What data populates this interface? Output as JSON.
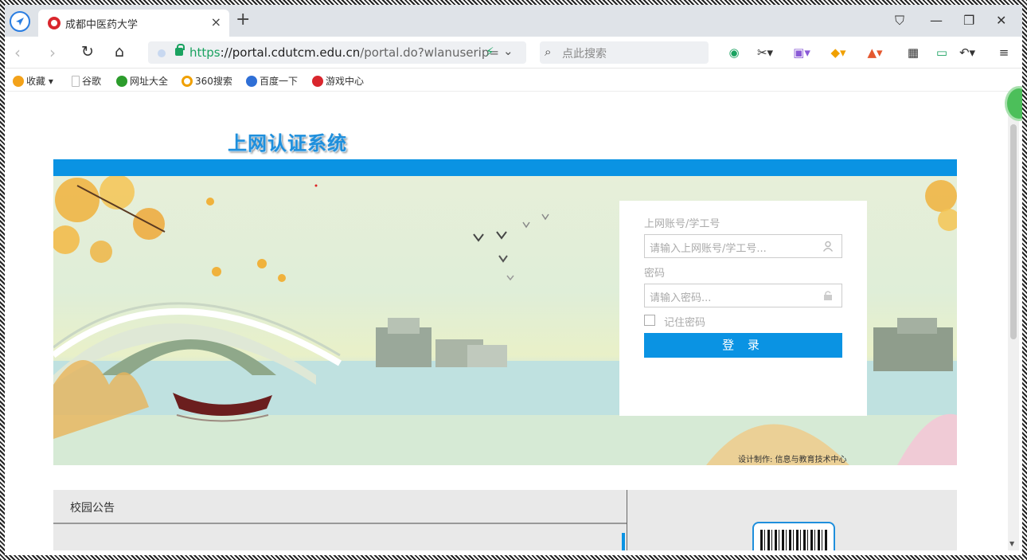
{
  "browser": {
    "tab_title": "成都中医药大学",
    "tab_close": "×",
    "new_tab": "+",
    "url_scheme": "https",
    "url_host": "://portal.cdutcm.edu.cn",
    "url_path": "/portal.do?wlanuserip=",
    "search_placeholder": "点此搜索",
    "window_controls": {
      "skin": "⛉",
      "minimize": "—",
      "restore": "❐",
      "close": "✕"
    },
    "toolbar_icons": [
      "shield-icon",
      "scissors-icon",
      "translate-icon",
      "coin-icon",
      "game-icon",
      "apps-icon",
      "battery-icon",
      "undo-icon",
      "menu-icon"
    ]
  },
  "bookmarks": [
    {
      "label": "收藏",
      "icon": "star-icon",
      "color": "#f3a21a"
    },
    {
      "label": "谷歌",
      "icon": "page-icon",
      "color": "#cccccc"
    },
    {
      "label": "网址大全",
      "icon": "globe-icon",
      "color": "#2c9c2c"
    },
    {
      "label": "360搜索",
      "icon": "search-360-icon",
      "color": "#f0a000"
    },
    {
      "label": "百度一下",
      "icon": "paw-icon",
      "color": "#2f6fd6"
    },
    {
      "label": "游戏中心",
      "icon": "game-center-icon",
      "color": "#d9262d"
    }
  ],
  "page": {
    "title": "上网认证系统",
    "login": {
      "account_label": "上网账号/学工号",
      "account_placeholder": "请输入上网账号/学工号...",
      "password_label": "密码",
      "password_placeholder": "请输入密码...",
      "remember_label": "记住密码",
      "submit_label": "登 录"
    },
    "credit": "设计制作: 信息与教育技术中心",
    "notice_title": "校园公告"
  },
  "colors": {
    "accent": "#0a93e3",
    "title_blue": "#1f8fdc",
    "secure_green": "#1aa260"
  }
}
